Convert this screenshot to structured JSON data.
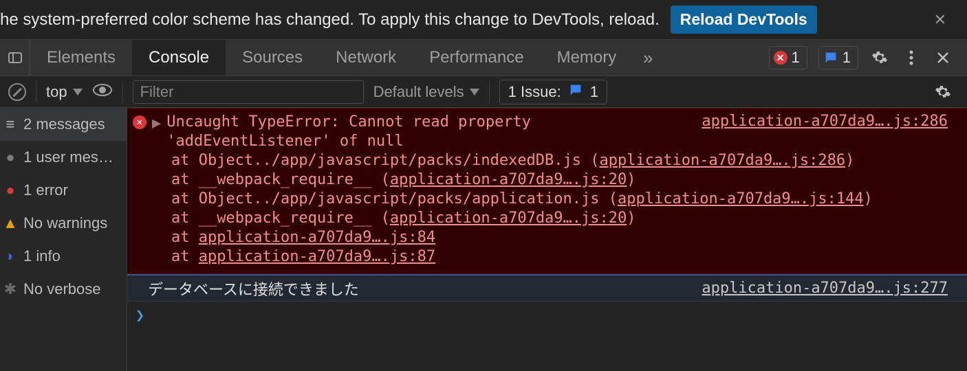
{
  "infobar": {
    "message": "he system-preferred color scheme has changed. To apply this change to DevTools, reload.",
    "button": "Reload DevTools"
  },
  "tabs": {
    "items": [
      "Elements",
      "Console",
      "Sources",
      "Network",
      "Performance",
      "Memory"
    ],
    "activeIndex": 1,
    "overflowGlyph": "»",
    "errorBadge": "1",
    "issueBadge": "1"
  },
  "toolbar": {
    "context": "top",
    "filterPlaceholder": "Filter",
    "levels": "Default levels",
    "issuesLabel": "1 Issue:",
    "issuesCount": "1"
  },
  "sidebar": {
    "items": [
      {
        "icon": "stack",
        "label": "2 messages"
      },
      {
        "icon": "dot-gray",
        "label": "1 user mes…"
      },
      {
        "icon": "dot-red",
        "label": "1 error"
      },
      {
        "icon": "tri-yellow",
        "label": "No warnings"
      },
      {
        "icon": "dot-blue",
        "label": "1 info"
      },
      {
        "icon": "gear-dim",
        "label": "No verbose"
      }
    ]
  },
  "console": {
    "error": {
      "message": "Uncaught TypeError: Cannot read property 'addEventListener' of null",
      "topLink": "application-a707da9….js:286",
      "stack": [
        {
          "prefix": "at Object../app/javascript/packs/indexedDB.js (",
          "link": "application-a707da9….js:286",
          "suffix": ")"
        },
        {
          "prefix": "at __webpack_require__ (",
          "link": "application-a707da9….js:20",
          "suffix": ")"
        },
        {
          "prefix": "at Object../app/javascript/packs/application.js (",
          "link": "application-a707da9….js:144",
          "suffix": ")"
        },
        {
          "prefix": "at __webpack_require__ (",
          "link": "application-a707da9….js:20",
          "suffix": ")"
        },
        {
          "prefix": "at ",
          "link": "application-a707da9….js:84",
          "suffix": ""
        },
        {
          "prefix": "at ",
          "link": "application-a707da9….js:87",
          "suffix": ""
        }
      ]
    },
    "info": {
      "message": "データベースに接続できました",
      "link": "application-a707da9….js:277"
    },
    "promptGlyph": "❯"
  }
}
